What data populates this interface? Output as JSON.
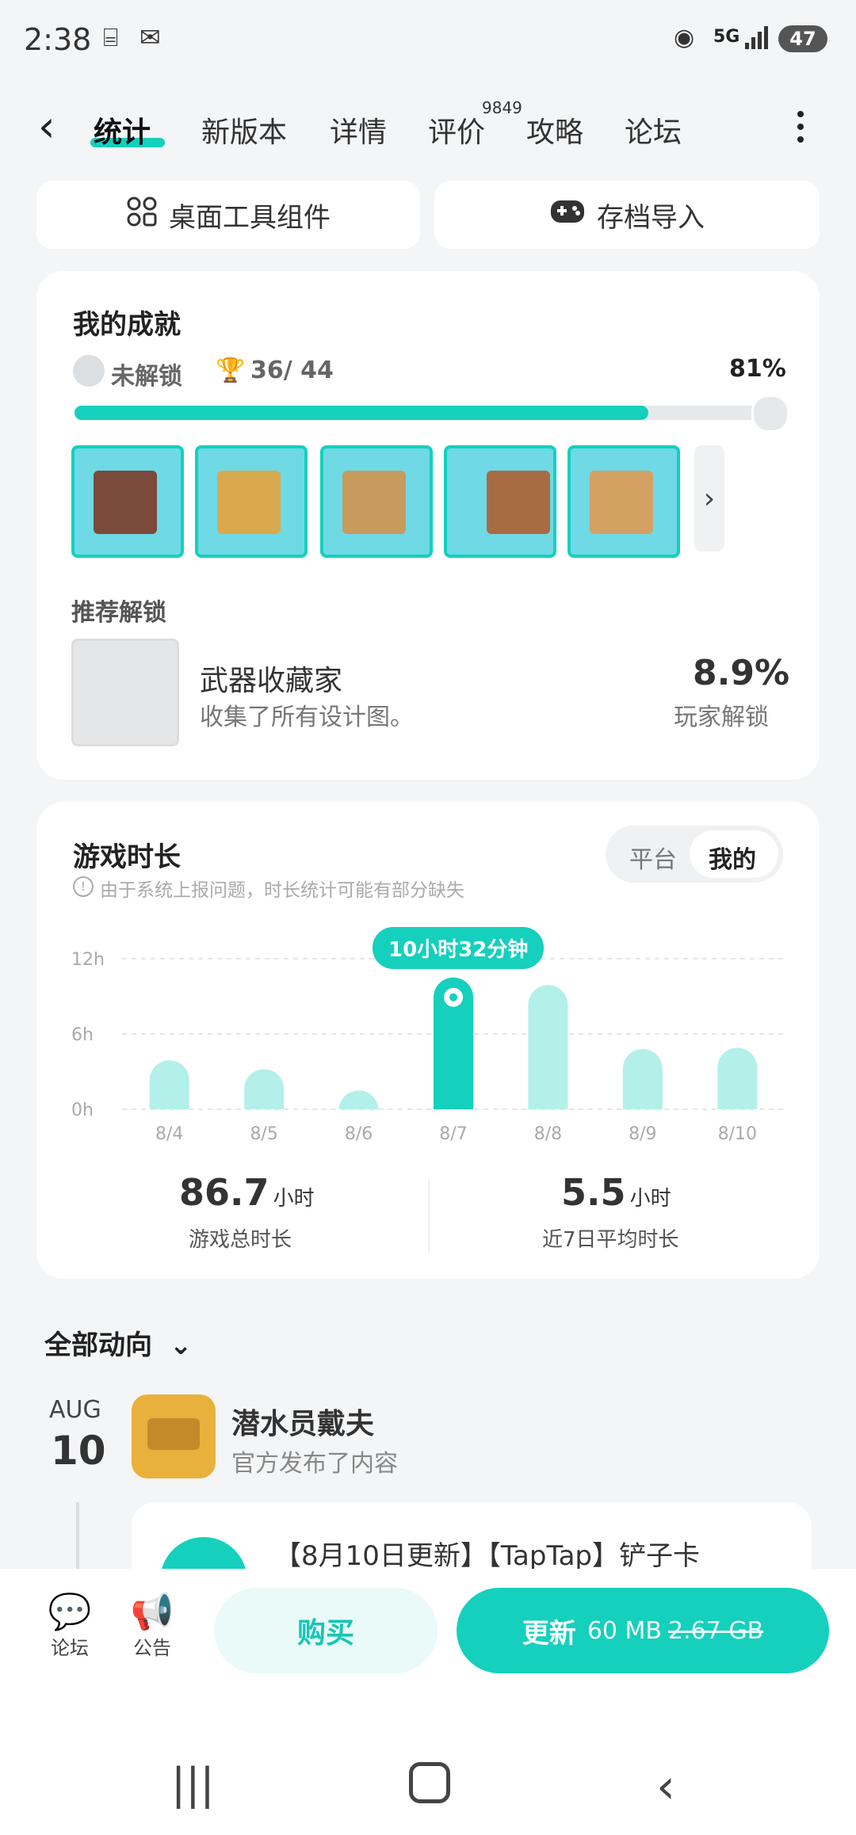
{
  "status_bar": {
    "time": "2:38",
    "network": "5G",
    "battery": "47"
  },
  "tabs": [
    {
      "label": "统计",
      "active": true
    },
    {
      "label": "新版本"
    },
    {
      "label": "详情"
    },
    {
      "label": "评价",
      "badge": "9849"
    },
    {
      "label": "攻略"
    },
    {
      "label": "论坛"
    }
  ],
  "top_buttons": {
    "widgets": "桌面工具组件",
    "import": "存档导入"
  },
  "achievements": {
    "title": "我的成就",
    "locked_label": "未解锁",
    "count": "36/ 44",
    "percent_label": "81%",
    "progress": 0.81,
    "recommend_title": "推荐解锁",
    "recommend_name": "武器收藏家",
    "recommend_desc": "收集了所有设计图。",
    "recommend_rate": "8.9%",
    "recommend_rate_label": "玩家解锁"
  },
  "playtime": {
    "title": "游戏时长",
    "notice": "由于系统上报问题，时长统计可能有部分缺失",
    "toggle": [
      "平台",
      "我的"
    ],
    "tooltip": "10小时32分钟",
    "total_value": "86.7",
    "total_unit": "小时",
    "total_label": "游戏总时长",
    "avg_value": "5.5",
    "avg_unit": "小时",
    "avg_label": "近7日平均时长"
  },
  "chart_data": {
    "type": "bar",
    "categories": [
      "8/4",
      "8/5",
      "8/6",
      "8/7",
      "8/8",
      "8/9",
      "8/10"
    ],
    "values": [
      3.9,
      3.2,
      1.5,
      10.5,
      9.9,
      4.8,
      4.9
    ],
    "ylim": [
      0,
      12
    ],
    "yticks": [
      "0h",
      "6h",
      "12h"
    ],
    "highlight_index": 3,
    "colors": {
      "bar": "#b3f0ea",
      "highlight": "#14d0bd"
    }
  },
  "feed": {
    "filter_label": "全部动向",
    "month": "AUG",
    "day": "10",
    "author": "潜水员戴夫",
    "action": "官方发布了内容",
    "post_title": "【8月10日更新】【TapTap】铲子卡"
  },
  "bottom": {
    "forum": "论坛",
    "announce": "公告",
    "buy": "购买",
    "update": "更新",
    "update_size": "60 MB",
    "full_size": "2.67 GB"
  },
  "colors": {
    "accent": "#14d0bd"
  }
}
